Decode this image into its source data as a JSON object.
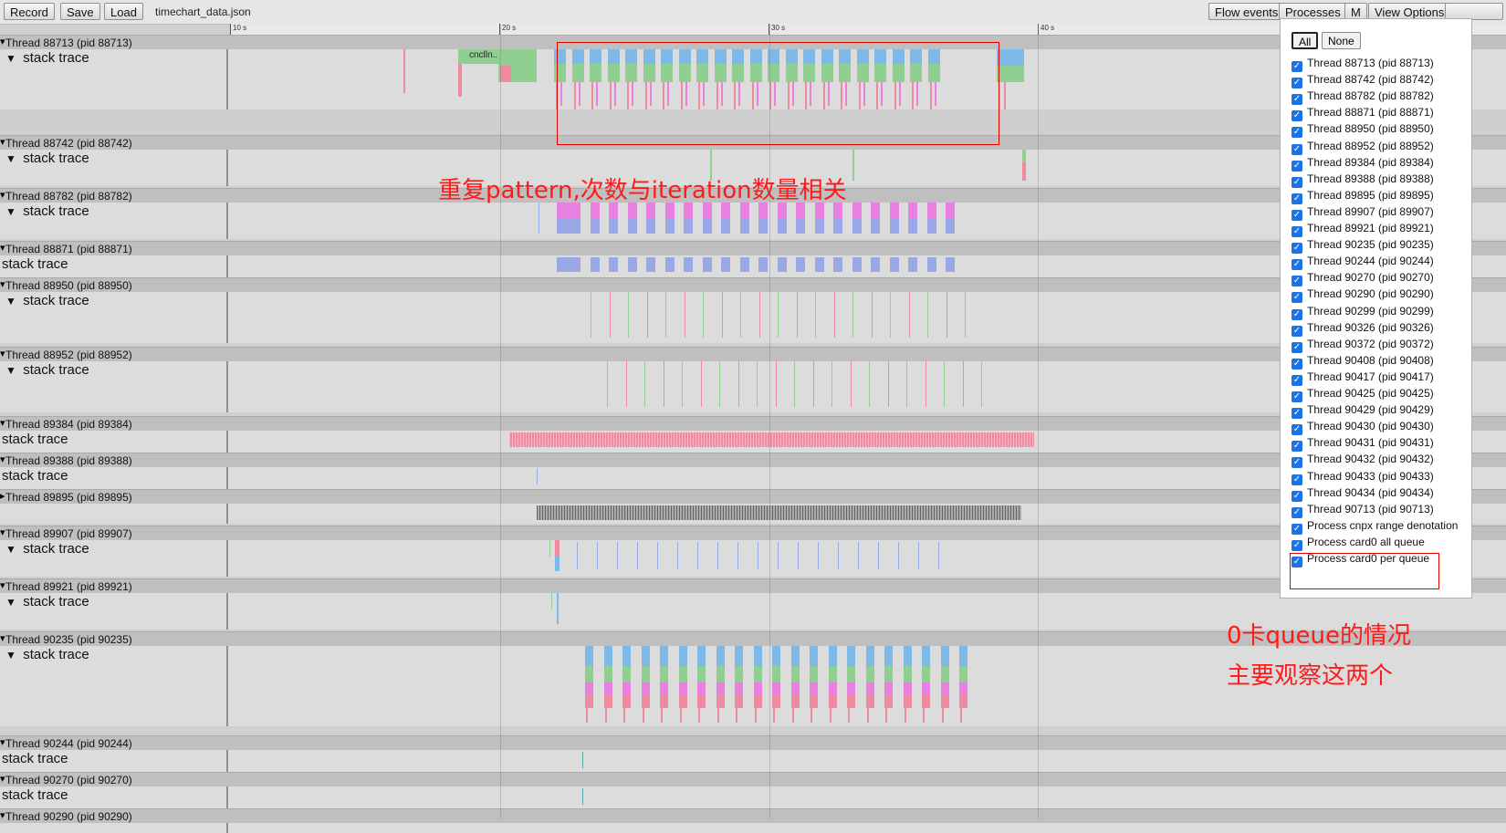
{
  "toolbar": {
    "record_label": "Record",
    "save_label": "Save",
    "load_label": "Load",
    "filename": "timechart_data.json",
    "flow_events_label": "Flow events",
    "processes_label": "Processes",
    "m_label": "M",
    "view_options_label": "View Options"
  },
  "ruler": {
    "ticks": [
      "10 s",
      "20 s",
      "30 s",
      "40 s"
    ]
  },
  "tracks": [
    {
      "header": "Thread 88713 (pid 88713)",
      "sub": "stack trace",
      "has_arrow": true,
      "slice_label": "cnclln..."
    },
    {
      "header": "Thread 88742 (pid 88742)",
      "sub": "stack trace",
      "has_arrow": true
    },
    {
      "header": "Thread 88782 (pid 88782)",
      "sub": "stack trace",
      "has_arrow": true
    },
    {
      "header": "Thread 88871 (pid 88871)",
      "sub": "stack trace",
      "has_arrow": false
    },
    {
      "header": "Thread 88950 (pid 88950)",
      "sub": "stack trace",
      "has_arrow": true
    },
    {
      "header": "Thread 88952 (pid 88952)",
      "sub": "stack trace",
      "has_arrow": true
    },
    {
      "header": "Thread 89384 (pid 89384)",
      "sub": "stack trace",
      "has_arrow": false
    },
    {
      "header": "Thread 89388 (pid 89388)",
      "sub": "stack trace",
      "has_arrow": false
    },
    {
      "header": "Thread 89895 (pid 89895)",
      "sub": "",
      "has_arrow": false
    },
    {
      "header": "Thread 89907 (pid 89907)",
      "sub": "stack trace",
      "has_arrow": true
    },
    {
      "header": "Thread 89921 (pid 89921)",
      "sub": "stack trace",
      "has_arrow": true
    },
    {
      "header": "Thread 90235 (pid 90235)",
      "sub": "stack trace",
      "has_arrow": true
    },
    {
      "header": "Thread 90244 (pid 90244)",
      "sub": "stack trace",
      "has_arrow": false
    },
    {
      "header": "Thread 90270 (pid 90270)",
      "sub": "stack trace",
      "has_arrow": false
    },
    {
      "header": "Thread 90290 (pid 90290)",
      "sub": "",
      "has_arrow": false
    }
  ],
  "processes_panel": {
    "all_label": "All",
    "none_label": "None",
    "items": [
      "Thread 88713 (pid 88713)",
      "Thread 88742 (pid 88742)",
      "Thread 88782 (pid 88782)",
      "Thread 88871 (pid 88871)",
      "Thread 88950 (pid 88950)",
      "Thread 88952 (pid 88952)",
      "Thread 89384 (pid 89384)",
      "Thread 89388 (pid 89388)",
      "Thread 89895 (pid 89895)",
      "Thread 89907 (pid 89907)",
      "Thread 89921 (pid 89921)",
      "Thread 90235 (pid 90235)",
      "Thread 90244 (pid 90244)",
      "Thread 90270 (pid 90270)",
      "Thread 90290 (pid 90290)",
      "Thread 90299 (pid 90299)",
      "Thread 90326 (pid 90326)",
      "Thread 90372 (pid 90372)",
      "Thread 90408 (pid 90408)",
      "Thread 90417 (pid 90417)",
      "Thread 90425 (pid 90425)",
      "Thread 90429 (pid 90429)",
      "Thread 90430 (pid 90430)",
      "Thread 90431 (pid 90431)",
      "Thread 90432 (pid 90432)",
      "Thread 90433 (pid 90433)",
      "Thread 90434 (pid 90434)",
      "Thread 90713 (pid 90713)",
      "Process cnpx range denotation",
      "Process card0 all queue",
      "Process card0 per queue"
    ]
  },
  "annotations": {
    "pattern_note": "重复pattern,次数与iteration数量相关",
    "queue_note_line1": "0卡queue的情况",
    "queue_note_line2": "主要观察这两个"
  },
  "colors": {
    "annotation_red": "#ff1a1a",
    "checkbox_blue": "#1a73e8",
    "slice_blue": "#7cb8e8",
    "slice_green": "#8fcf8f",
    "slice_pink": "#f08aa0",
    "slice_magenta": "#e880e0",
    "slice_periwinkle": "#9aa8e8"
  }
}
